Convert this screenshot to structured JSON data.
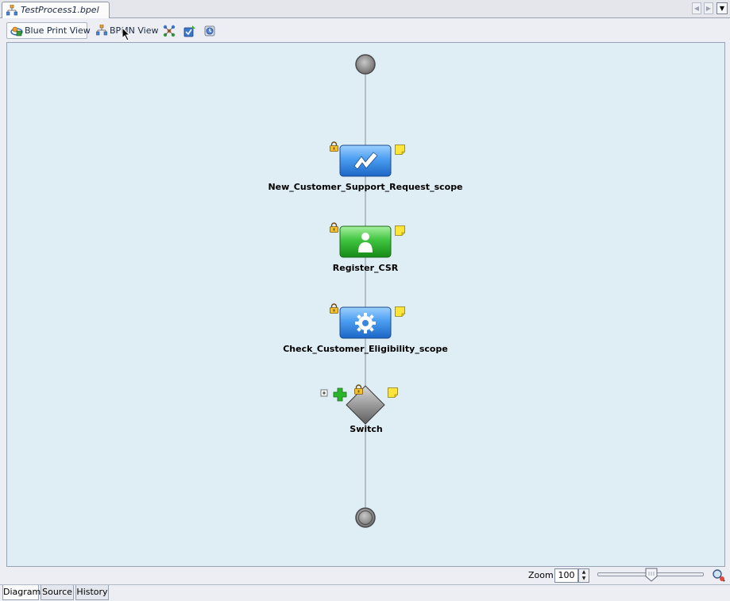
{
  "editor_tab": {
    "title": "TestProcess1.bpel",
    "icon": "bpel-process-icon"
  },
  "tab_nav": {
    "prev_icon": "scroll-left-icon",
    "next_icon": "scroll-right-icon",
    "menu_icon": "tab-list-dropdown-icon"
  },
  "toolbar": {
    "blueprint_label": "Blue Print View",
    "bpmn_label": "BPMN View",
    "icons": [
      "auto-layout-icon",
      "validate-icon",
      "process-map-icon"
    ]
  },
  "diagram": {
    "start_node": "start-node",
    "end_node": "end-node",
    "activities": [
      {
        "label": "New_Customer_Support_Request_scope",
        "type": "scope",
        "icon": "scope-lightning-icon",
        "color": "#3f8fe0"
      },
      {
        "label": "Register_CSR",
        "type": "human-task",
        "icon": "user-icon",
        "color": "#3fbf3f"
      },
      {
        "label": "Check_Customer_Eligibility_scope",
        "type": "scope",
        "icon": "gear-icon",
        "color": "#3f8fe0"
      },
      {
        "label": "Switch",
        "type": "switch",
        "icon": "diamond-icon",
        "color": "#8a8a8a"
      }
    ],
    "badges": [
      "lock-icon",
      "note-icon"
    ]
  },
  "zoom": {
    "label": "Zoom:",
    "value": "100",
    "percent": 0.5
  },
  "bottom_tabs": [
    "Diagram",
    "Source",
    "History"
  ],
  "colors": {
    "canvas": "#dfedf5",
    "connector": "#8a8f96"
  }
}
